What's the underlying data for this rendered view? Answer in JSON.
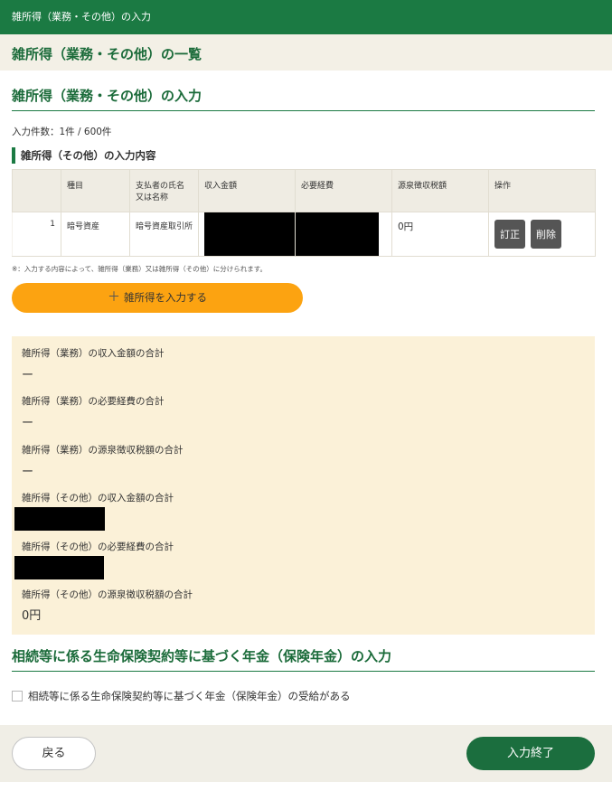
{
  "header": {
    "title": "雑所得（業務・その他）の入力"
  },
  "list_section": {
    "title": "雑所得（業務・その他）の一覧"
  },
  "input_section": {
    "title": "雑所得（業務・その他）の入力",
    "count_text": "入力件数：1件 / 600件",
    "sub_title": "雑所得（その他）の入力内容",
    "table": {
      "columns": [
        "",
        "種目",
        "支払者の氏名\n又は名称",
        "収入金額",
        "必要経費",
        "源泉徴収税額",
        "操作"
      ],
      "rows": [
        {
          "no": "1",
          "type": "暗号資産",
          "payer": "暗号資産取引所",
          "income": "",
          "expense": "",
          "withholding": "0円",
          "edit_label": "訂正",
          "delete_label": "削除"
        }
      ]
    },
    "note": "※：入力する内容によって、雑所得（業務）又は雑所得（その他）に分けられます。",
    "add_button": {
      "icon": "plus-icon",
      "label": "雑所得を入力する"
    }
  },
  "summary": {
    "items": [
      {
        "label": "雑所得（業務）の収入金額の合計",
        "value": "ー"
      },
      {
        "label": "雑所得（業務）の必要経費の合計",
        "value": "ー"
      },
      {
        "label": "雑所得（業務）の源泉徴収税額の合計",
        "value": "ー"
      },
      {
        "label": "雑所得（その他）の収入金額の合計",
        "value": ""
      },
      {
        "label": "雑所得（その他）の必要経費の合計",
        "value": ""
      },
      {
        "label": "雑所得（その他）の源泉徴収税額の合計",
        "value": "0円"
      }
    ]
  },
  "pension_section": {
    "title": "相続等に係る生命保険契約等に基づく年金（保険年金）の入力",
    "checkbox_label": "相続等に係る生命保険契約等に基づく年金（保険年金）の受給がある",
    "checked": false
  },
  "footer": {
    "back_label": "戻る",
    "done_label": "入力終了"
  },
  "colors": {
    "brand_green": "#1b7a43",
    "accent_orange": "#fca311",
    "summary_bg": "#fbf1d8"
  }
}
